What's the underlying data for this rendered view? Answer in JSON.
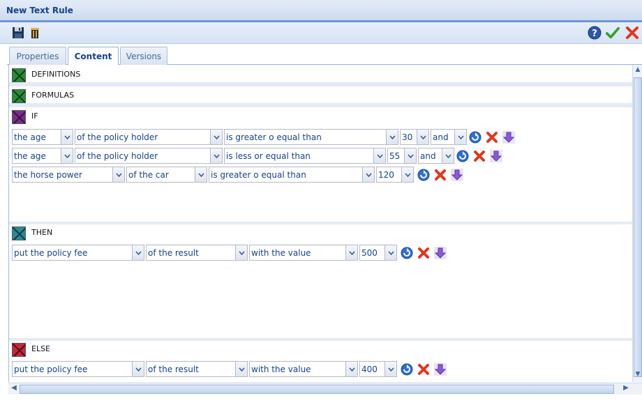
{
  "window": {
    "title": "New Text Rule"
  },
  "toolbar": {
    "left": [
      "save-icon",
      "delete-icon"
    ],
    "right": [
      "help-icon",
      "accept-icon",
      "close-icon"
    ]
  },
  "tabs": [
    {
      "label": "Properties",
      "active": false
    },
    {
      "label": "Content",
      "active": true
    },
    {
      "label": "Versions",
      "active": false
    }
  ],
  "sections": {
    "definitions": {
      "label": "DEFINITIONS",
      "color": "#2a8c3a"
    },
    "formulas": {
      "label": "FORMULAS",
      "color": "#2a8c3a"
    },
    "if": {
      "label": "IF",
      "color": "#7a2f8a"
    },
    "then": {
      "label": "THEN",
      "color": "#2a8a96"
    },
    "else": {
      "label": "ELSE",
      "color": "#c2283c"
    }
  },
  "if_rows": [
    {
      "subject": "the age",
      "scope": "of the policy holder",
      "operator": "is greater o equal than",
      "value": "30",
      "connector": "and"
    },
    {
      "subject": "the age",
      "scope": "of the policy holder",
      "operator": "is less or equal than",
      "value": "55",
      "connector": "and"
    },
    {
      "subject": "the horse power",
      "scope": "of the car",
      "operator": "is greater o equal than",
      "value": "120"
    }
  ],
  "then_rows": [
    {
      "action": "put the policy fee",
      "scope": "of the result",
      "operator": "with the value",
      "value": "500"
    }
  ],
  "else_rows": [
    {
      "action": "put the policy fee",
      "scope": "of the result",
      "operator": "with the value",
      "value": "400"
    }
  ]
}
